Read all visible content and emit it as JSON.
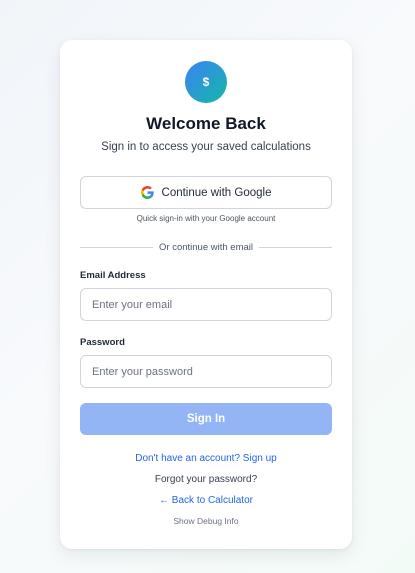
{
  "logo": {
    "symbol": "$"
  },
  "header": {
    "title": "Welcome Back",
    "subtitle": "Sign in to access your saved calculations"
  },
  "google": {
    "button_label": "Continue with Google",
    "hint": "Quick sign-in with your Google account"
  },
  "divider": {
    "text": "Or continue with email"
  },
  "form": {
    "email_label": "Email Address",
    "email_placeholder": "Enter your email",
    "password_label": "Password",
    "password_placeholder": "Enter your password",
    "submit_label": "Sign In"
  },
  "links": {
    "signup": "Don't have an account? Sign up",
    "forgot": "Forgot your password?",
    "back": "← Back to Calculator",
    "debug": "Show Debug Info"
  },
  "colors": {
    "accent": "#2563eb",
    "button_disabled": "#93b4f5",
    "logo_gradient_start": "#3b82f6",
    "logo_gradient_end": "#14b8a6"
  },
  "icons": {
    "google": "google-g-icon"
  }
}
